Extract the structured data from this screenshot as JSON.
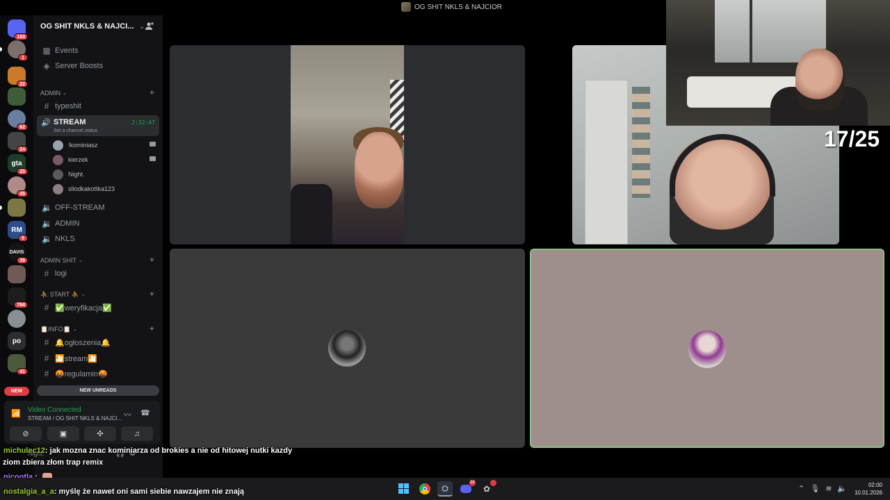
{
  "window": {
    "title": "OG SHIT NKLS & NAJCIOR"
  },
  "rail": {
    "servers": [
      {
        "name": "discord-home",
        "badge": "183",
        "color": "#5865f2"
      },
      {
        "name": "server-2",
        "badge": "1",
        "color": "#7c6f6a"
      },
      {
        "name": "server-3",
        "badge": "22",
        "color": "#c97a2a"
      },
      {
        "name": "server-4",
        "badge": "",
        "color": "#3f5c3a"
      },
      {
        "name": "server-5",
        "badge": "62",
        "color": "#6a7ea0"
      },
      {
        "name": "server-6",
        "badge": "24",
        "color": "#444"
      },
      {
        "name": "server-gta",
        "badge": "25",
        "color": "#1f3d28",
        "text": "gta"
      },
      {
        "name": "server-8",
        "badge": "45",
        "color": "#b08a86"
      },
      {
        "name": "server-9",
        "badge": "",
        "color": "#7d7746"
      },
      {
        "name": "server-10",
        "badge": "9",
        "color": "#2b4e8a",
        "text": "RM"
      },
      {
        "name": "server-davis",
        "badge": "39",
        "color": "#151515",
        "text": "DAVIS"
      },
      {
        "name": "server-12",
        "badge": "",
        "color": "#6f5a55"
      },
      {
        "name": "server-13",
        "badge": "784",
        "color": "#1d1d1d"
      },
      {
        "name": "server-14",
        "badge": "",
        "color": "#8b8f94"
      },
      {
        "name": "server-po",
        "badge": "",
        "color": "#2b2d31",
        "text": "po"
      },
      {
        "name": "server-16",
        "badge": "41",
        "color": "#4b5a3c"
      }
    ],
    "new_label": "NEW"
  },
  "sidebar": {
    "server_name": "OG SHIT NKLS & NAJCI...",
    "events": "Events",
    "boosts": "Server Boosts",
    "cat_admin": "ADMIN",
    "ch_typeshit": "typeshit",
    "stream": {
      "name": "STREAM",
      "time": "2:32:47",
      "status": "Set a channel status"
    },
    "members": [
      {
        "name": "!kominiasz",
        "cam": true,
        "color": "#9aa3ad"
      },
      {
        "name": "kierzek",
        "cam": true,
        "color": "#7a5a66"
      },
      {
        "name": "Night.",
        "cam": false,
        "color": "#5a5a5a"
      },
      {
        "name": "sllodkakottka123",
        "cam": false,
        "color": "#8e7f80"
      }
    ],
    "ch_offstream": "OFF-STREAM",
    "ch_admin": "ADMIN",
    "ch_nkls": "NKLS",
    "cat_adminshit": "ADMIN SHIT",
    "ch_logi": "logi",
    "cat_start": "⛹ START ⛹",
    "ch_weryfikacja": "✅weryfikacja✅",
    "cat_info": "📋INFO📋",
    "ch_ogloszenia": "🔔ogłoszenia🔔",
    "ch_stream2": "🎦stream🎦",
    "ch_regulamin": "🤬regulamin🤬",
    "new_unreads": "NEW UNREADS"
  },
  "voice": {
    "title": "Video Connected",
    "subtitle": "STREAM / OG SHIT NKLS & NAJCI...",
    "username": "Night."
  },
  "overlay": {
    "counter": "17/25"
  },
  "chat": [
    {
      "user": "michulec12",
      "user_color": "#9acd32",
      "text": ": jak mozna znac kominiarza od brokies a nie od hitowej nutki kazdy"
    },
    {
      "user": "",
      "user_color": "#ffffff",
      "text": "ziom zbiera złom trap remix"
    },
    {
      "user": "nicootla",
      "user_color": "#b57cff",
      "text": " :"
    },
    {
      "user": "nostalgia_a_a",
      "user_color": "#9acd32",
      "text": ": myślę że nawet oni sami siebie nawzajem nie znają"
    }
  ],
  "taskbar": {
    "discord_badge": "34",
    "time": "02:00",
    "date": "10.01.2026"
  }
}
